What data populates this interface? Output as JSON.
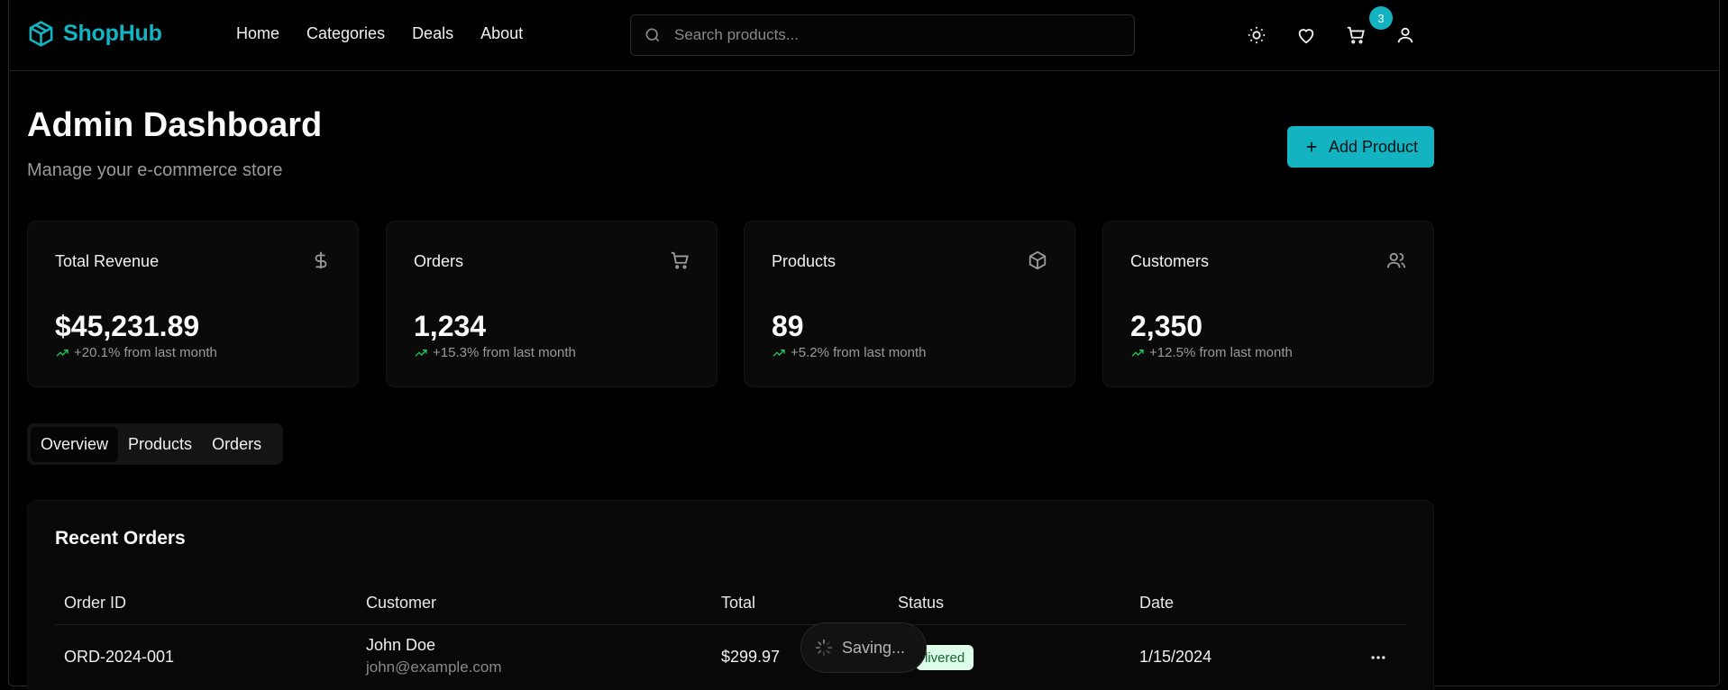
{
  "brand": {
    "name": "ShopHub",
    "accent": "#13b3c2"
  },
  "nav": [
    "Home",
    "Categories",
    "Deals",
    "About"
  ],
  "search": {
    "placeholder": "Search products..."
  },
  "header_icons": [
    "sun-icon",
    "heart-icon",
    "cart-icon",
    "user-icon"
  ],
  "cart_count": "3",
  "page": {
    "title": "Admin Dashboard",
    "subtitle": "Manage your e-commerce store"
  },
  "add_product_label": "Add Product",
  "stats": [
    {
      "title": "Total Revenue",
      "value": "$45,231.89",
      "change": "+20.1% from last month",
      "icon": "dollar-icon"
    },
    {
      "title": "Orders",
      "value": "1,234",
      "change": "+15.3% from last month",
      "icon": "cart-icon"
    },
    {
      "title": "Products",
      "value": "89",
      "change": "+5.2% from last month",
      "icon": "box-icon"
    },
    {
      "title": "Customers",
      "value": "2,350",
      "change": "+12.5% from last month",
      "icon": "users-icon"
    }
  ],
  "tabs": [
    "Overview",
    "Products",
    "Orders"
  ],
  "active_tab": "Overview",
  "recent_orders": {
    "title": "Recent Orders",
    "columns": [
      "Order ID",
      "Customer",
      "Total",
      "Status",
      "Date"
    ],
    "rows": [
      {
        "id": "ORD-2024-001",
        "customer": "John Doe",
        "email": "john@example.com",
        "total": "$299.97",
        "status": "livered",
        "date": "1/15/2024"
      }
    ]
  },
  "toast": "Saving...",
  "colors": {
    "trend_up": "#22c55e",
    "status_delivered_bg": "#dcfce7",
    "status_delivered_fg": "#166534"
  }
}
